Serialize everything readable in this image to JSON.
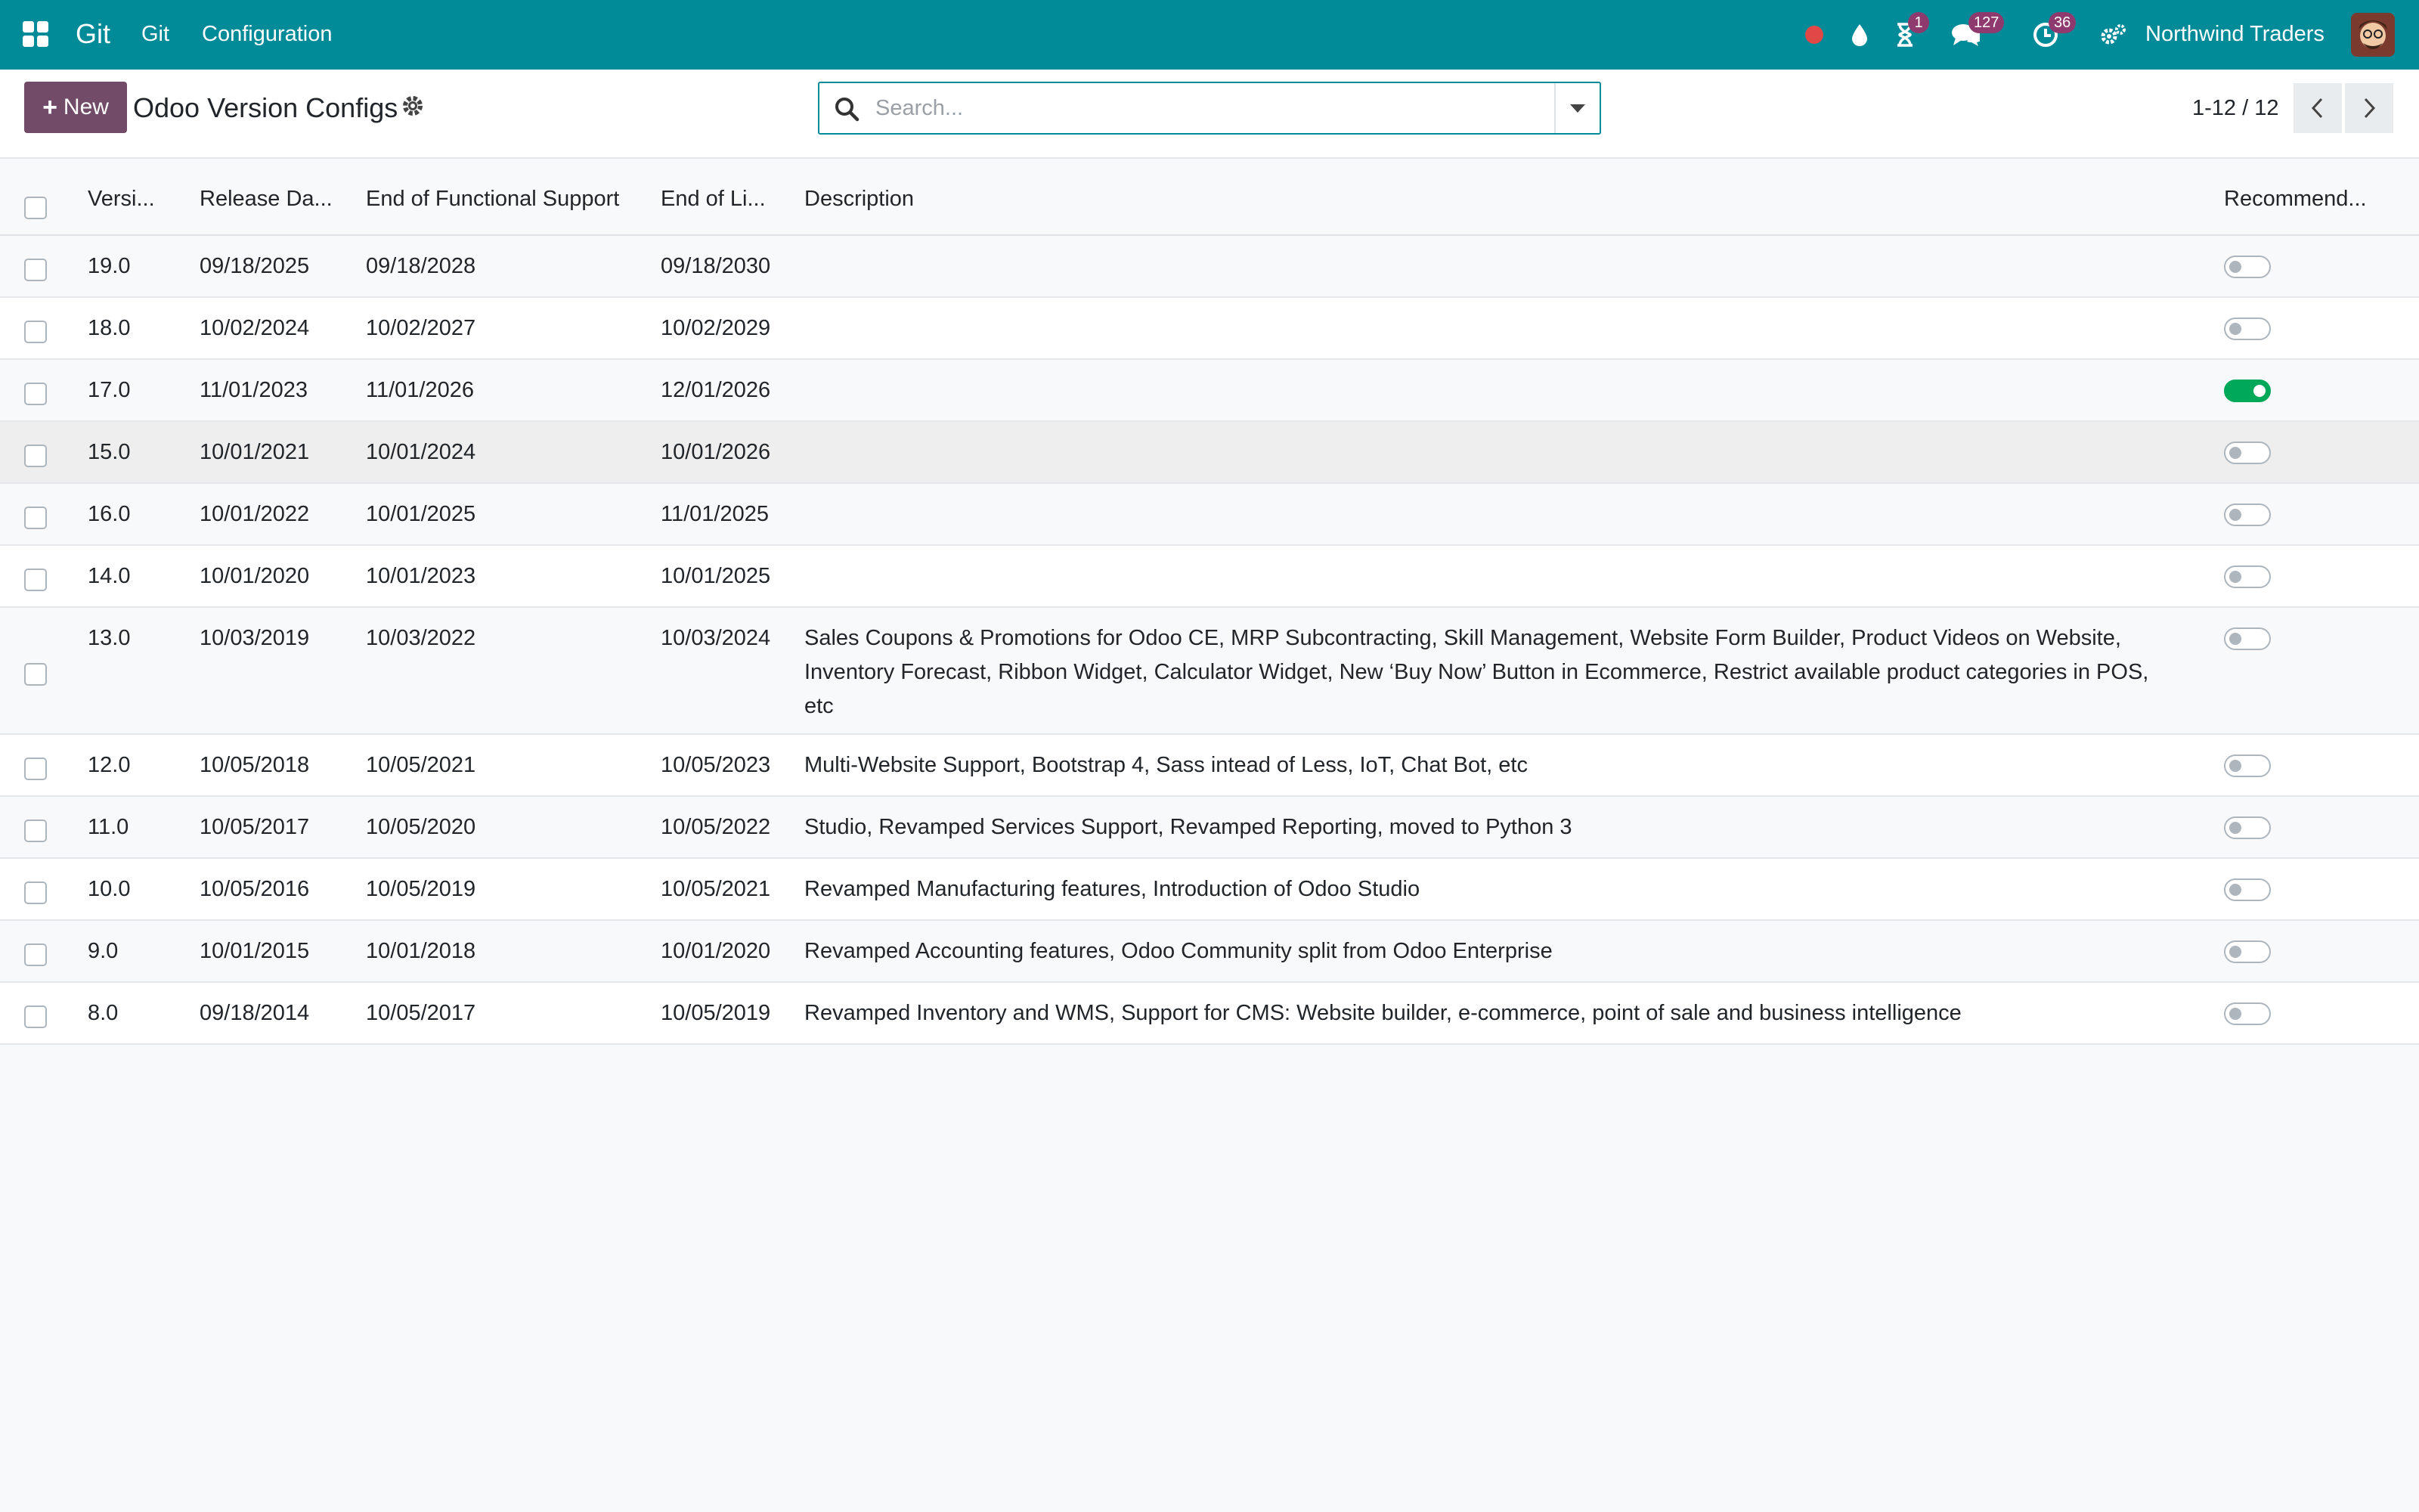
{
  "navbar": {
    "brand": "Git",
    "menus": [
      "Git",
      "Configuration"
    ],
    "company": "Northwind Traders",
    "badges": {
      "activities": "1",
      "messages": "127",
      "timer": "36"
    },
    "colors": {
      "bar": "#018a98",
      "badge": "#8e3a6e",
      "record": "#e04848"
    }
  },
  "control": {
    "new_label": "New",
    "title": "Odoo Version Configs",
    "search_placeholder": "Search...",
    "pager": "1-12 / 12"
  },
  "table": {
    "columns": [
      "Versi...",
      "Release Da...",
      "End of Functional Support",
      "End of Li...",
      "Description",
      "Recommend..."
    ],
    "rows": [
      {
        "version": "19.0",
        "release": "09/18/2025",
        "functional": "09/18/2028",
        "life": "09/18/2030",
        "description": "",
        "recommended": false
      },
      {
        "version": "18.0",
        "release": "10/02/2024",
        "functional": "10/02/2027",
        "life": "10/02/2029",
        "description": "",
        "recommended": false
      },
      {
        "version": "17.0",
        "release": "11/01/2023",
        "functional": "11/01/2026",
        "life": "12/01/2026",
        "description": "",
        "recommended": true
      },
      {
        "version": "15.0",
        "release": "10/01/2021",
        "functional": "10/01/2024",
        "life": "10/01/2026",
        "description": "",
        "recommended": false
      },
      {
        "version": "16.0",
        "release": "10/01/2022",
        "functional": "10/01/2025",
        "life": "11/01/2025",
        "description": "",
        "recommended": false
      },
      {
        "version": "14.0",
        "release": "10/01/2020",
        "functional": "10/01/2023",
        "life": "10/01/2025",
        "description": "",
        "recommended": false
      },
      {
        "version": "13.0",
        "release": "10/03/2019",
        "functional": "10/03/2022",
        "life": "10/03/2024",
        "description": "Sales Coupons & Promotions for Odoo CE, MRP Subcontracting, Skill Management, Website Form Builder, Product Videos on Website, Inventory Forecast, Ribbon Widget, Calculator Widget, New ‘Buy Now’ Button in Ecommerce, Restrict available product categories in POS, etc",
        "recommended": false
      },
      {
        "version": "12.0",
        "release": "10/05/2018",
        "functional": "10/05/2021",
        "life": "10/05/2023",
        "description": "Multi-Website Support, Bootstrap 4, Sass intead of Less, IoT, Chat Bot, etc",
        "recommended": false
      },
      {
        "version": "11.0",
        "release": "10/05/2017",
        "functional": "10/05/2020",
        "life": "10/05/2022",
        "description": "Studio, Revamped Services Support, Revamped Reporting, moved to Python 3",
        "recommended": false
      },
      {
        "version": "10.0",
        "release": "10/05/2016",
        "functional": "10/05/2019",
        "life": "10/05/2021",
        "description": "Revamped Manufacturing features, Introduction of Odoo Studio",
        "recommended": false
      },
      {
        "version": "9.0",
        "release": "10/01/2015",
        "functional": "10/01/2018",
        "life": "10/01/2020",
        "description": "Revamped Accounting features, Odoo Community split from Odoo Enterprise",
        "recommended": false
      },
      {
        "version": "8.0",
        "release": "09/18/2014",
        "functional": "10/05/2017",
        "life": "10/05/2019",
        "description": "Revamped Inventory and WMS, Support for CMS: Website builder, e-commerce, point of sale and business intelligence",
        "recommended": false
      }
    ]
  }
}
